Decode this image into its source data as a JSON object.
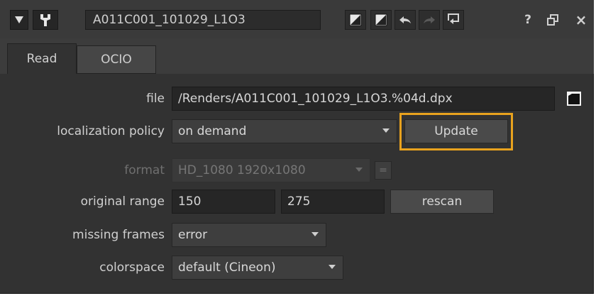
{
  "window": {
    "node_name": "A011C001_101029_L1O3",
    "help_label": "?",
    "float_label": "Ɛ",
    "close_label": "×"
  },
  "tabs": [
    {
      "label": "Read",
      "active": true
    },
    {
      "label": "OCIO",
      "active": false
    }
  ],
  "knobs": {
    "file": {
      "label": "file",
      "value": "/Renders/A011C001_101029_L1O3.%04d.dpx"
    },
    "localization_policy": {
      "label": "localization policy",
      "value": "on demand",
      "update_label": "Update"
    },
    "format": {
      "label": "format",
      "value": "HD_1080 1920x1080",
      "extra_label": "="
    },
    "original_range": {
      "label": "original range",
      "first": "150",
      "last": "275",
      "rescan_label": "rescan"
    },
    "missing_frames": {
      "label": "missing frames",
      "value": "error"
    },
    "colorspace": {
      "label": "colorspace",
      "value": "default (Cineon)"
    }
  },
  "colors": {
    "panel": "#323232",
    "field": "#262626",
    "highlight": "#e8a21e"
  }
}
